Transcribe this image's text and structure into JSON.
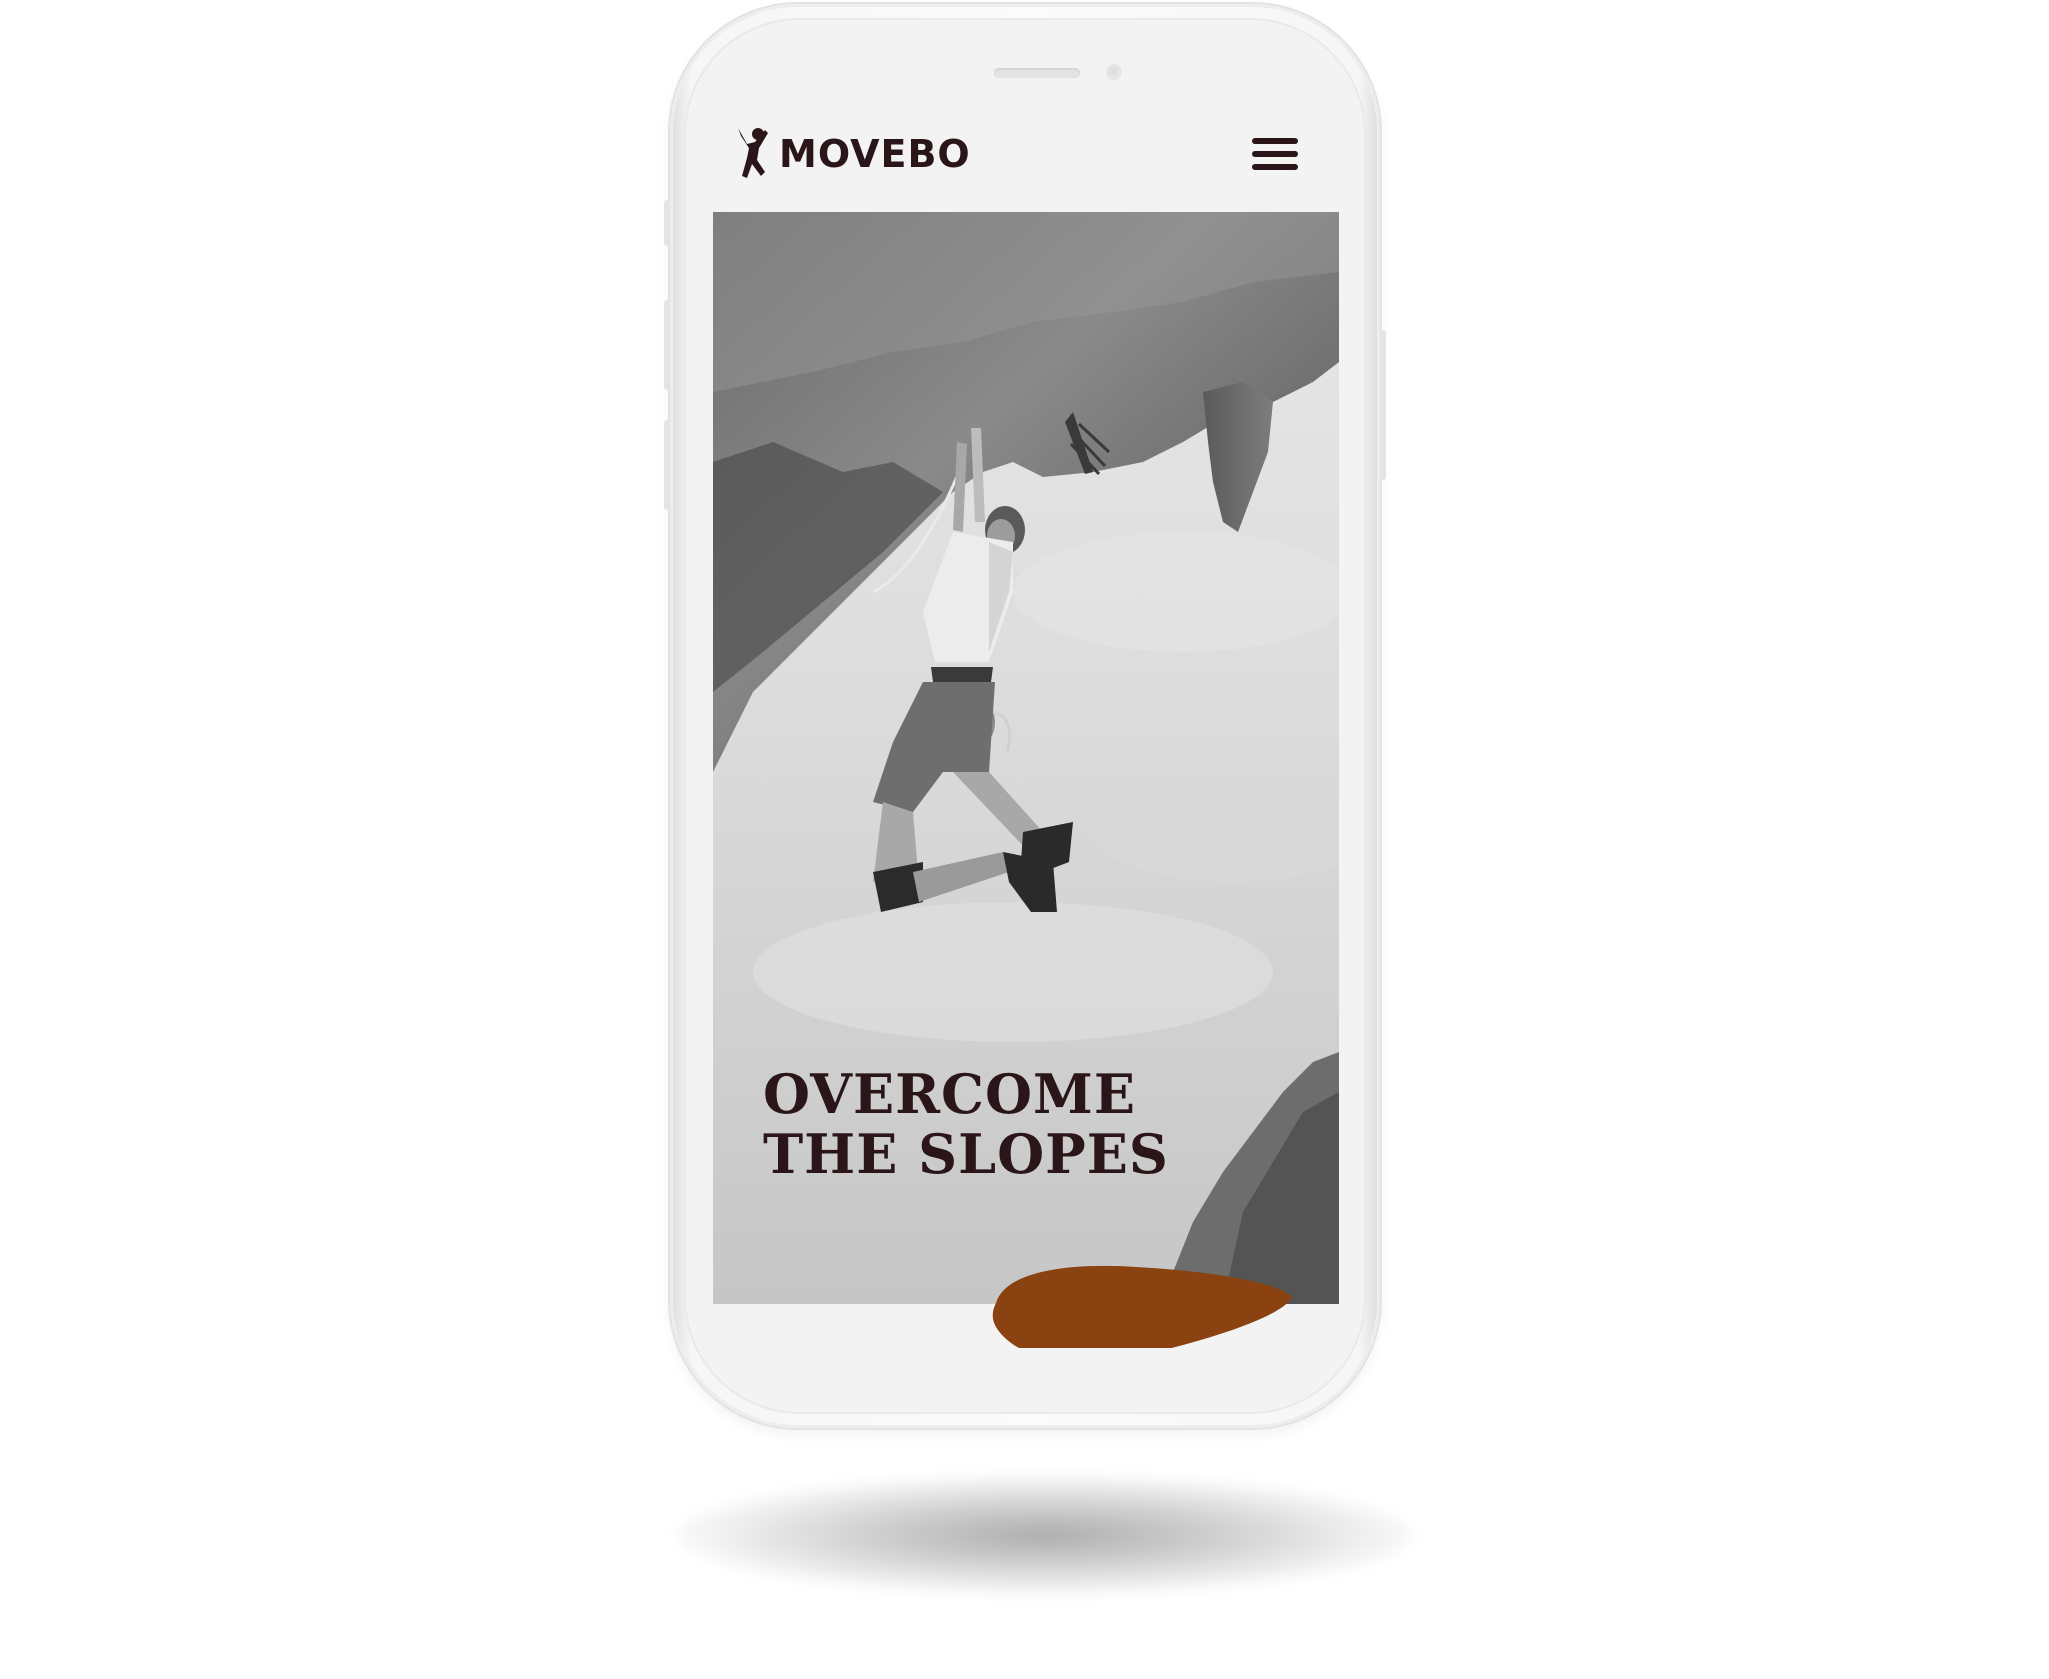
{
  "brand": {
    "name": "MOVEBO",
    "logo_icon": "climber-figure-icon",
    "text_color": "#2a1618"
  },
  "header": {
    "menu_icon": "hamburger-menu-icon"
  },
  "hero": {
    "image": "black-and-white photo of a rock climber hanging from an overhanging cliff",
    "title_line_1": "OVERCOME",
    "title_line_2": "THE SLOPES"
  },
  "accent": {
    "blob_color": "#8a4210"
  }
}
